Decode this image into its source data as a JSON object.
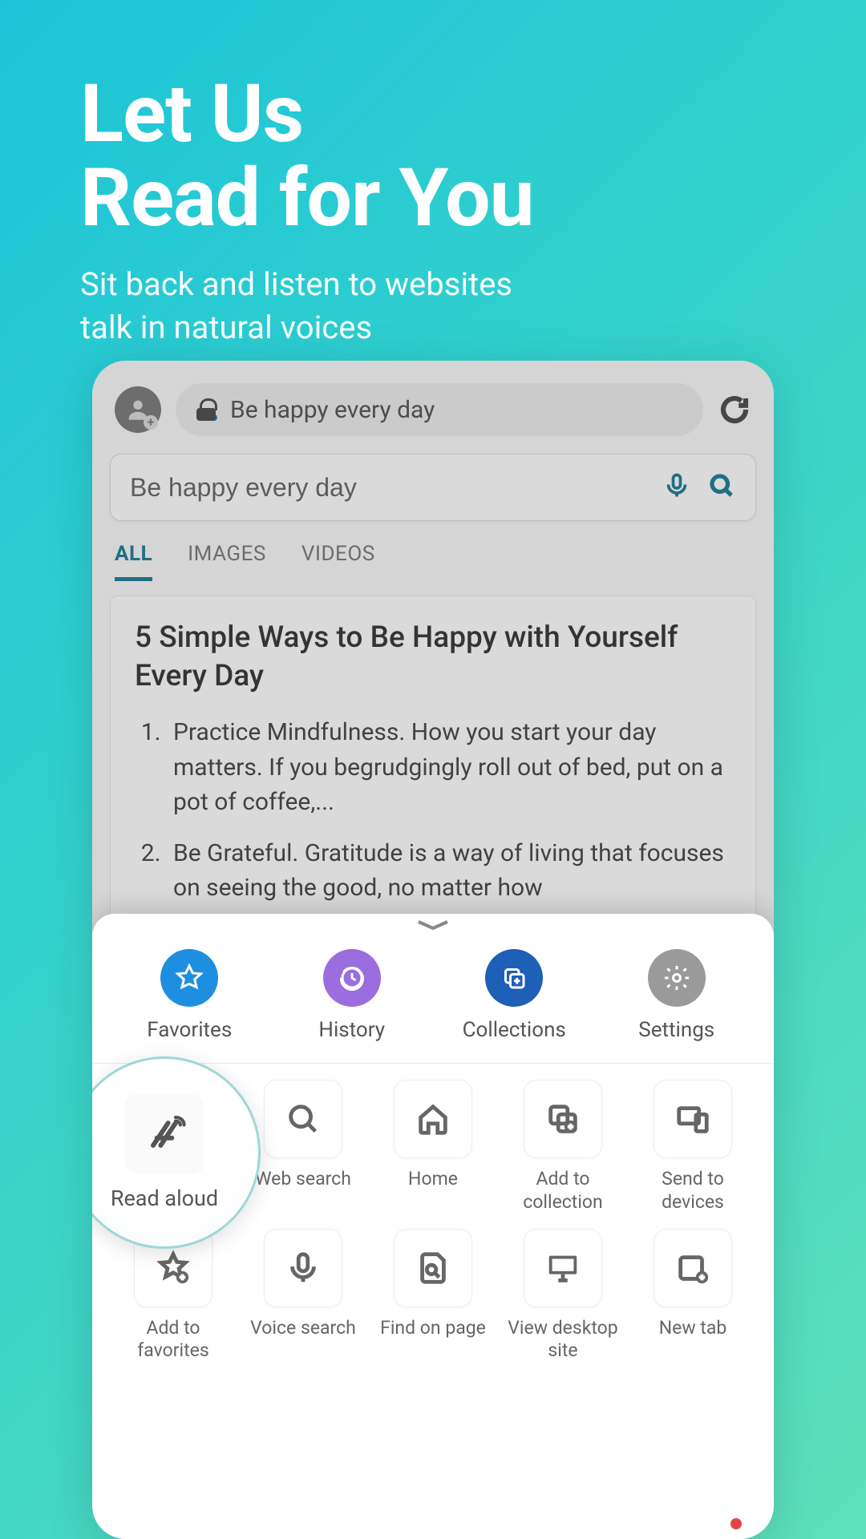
{
  "hero": {
    "title_line1": "Let Us",
    "title_line2": "Read for You",
    "subtitle_line1": "Sit back and listen to websites",
    "subtitle_line2": "talk in natural voices"
  },
  "browser": {
    "address_text": "Be happy every day",
    "search_value": "Be happy every day",
    "tabs": {
      "all": "ALL",
      "images": "IMAGES",
      "videos": "VIDEOS"
    },
    "result": {
      "title": "5 Simple Ways to Be Happy with Yourself Every Day",
      "item1": "Practice Mindfulness. How you start your day matters. If you begrudgingly roll out of bed, put on a pot of coffee,...",
      "item2": "Be Grateful. Gratitude is a way of living that focuses on seeing the good, no matter how"
    }
  },
  "sheet": {
    "top": {
      "favorites": "Favorites",
      "history": "History",
      "collections": "Collections",
      "settings": "Settings"
    },
    "highlight": {
      "label": "Read aloud"
    },
    "grid": {
      "web_search": "Web search",
      "home": "Home",
      "add_to_collection": "Add to collection",
      "send_to_devices": "Send to devices",
      "add_to_favorites": "Add to favorites",
      "voice_search": "Voice search",
      "find_on_page": "Find on page",
      "view_desktop_site": "View desktop site",
      "new_tab": "New tab"
    }
  }
}
